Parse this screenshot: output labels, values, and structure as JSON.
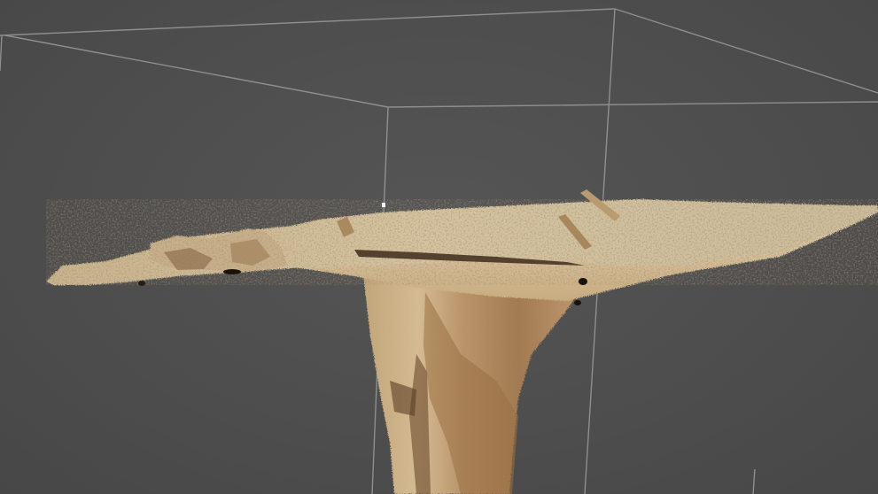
{
  "viewport": {
    "background_color": "#4f4f4f",
    "bounding_box_color": "#9a9a9a",
    "model": {
      "type": "point-cloud-mesh",
      "colors": {
        "surface_light": "#d8c7a6",
        "surface_mid": "#bfa57c",
        "surface_dark": "#8a6a44",
        "shadow": "#5a4026",
        "bright_speckle": "#ece3d2"
      }
    }
  }
}
